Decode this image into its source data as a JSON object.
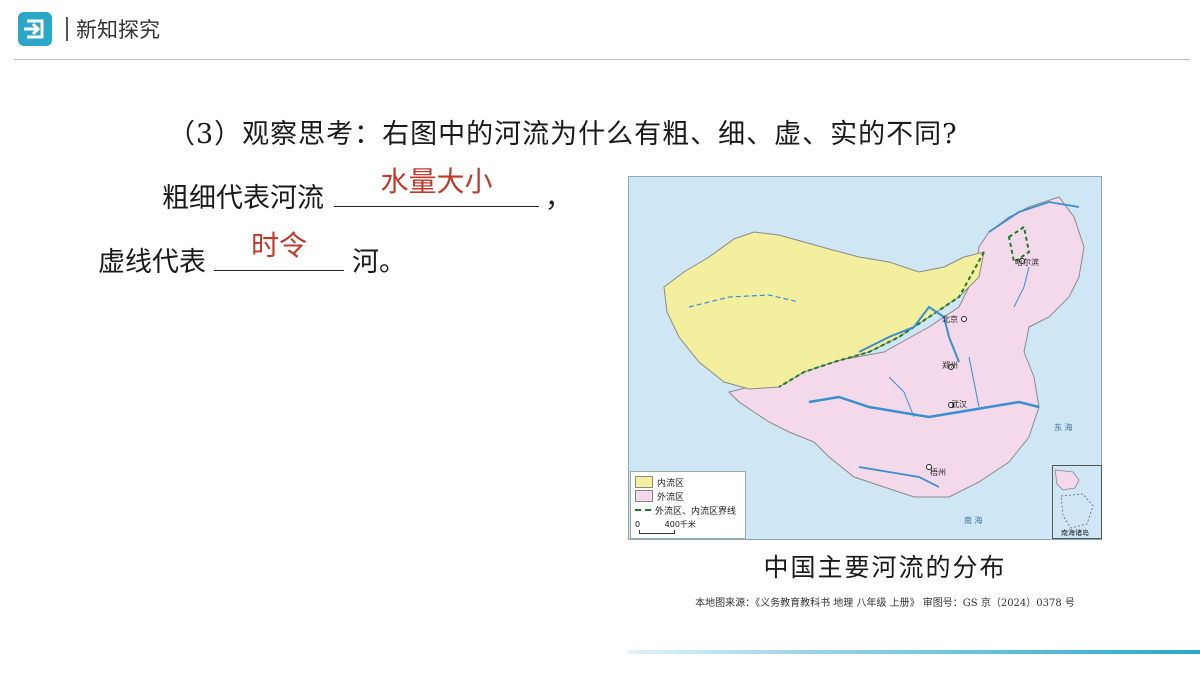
{
  "header": {
    "logo_icon": "return-arrow-icon",
    "title": "新知探究",
    "accent_color": "#2aa7c9"
  },
  "question": {
    "text": "（3）观察思考：右图中的河流为什么有粗、细、虚、实的不同?"
  },
  "line1": {
    "prefix": "粗细代表河流",
    "answer": "水量大小",
    "suffix": "，"
  },
  "line2": {
    "prefix": "虚线代表",
    "answer": "时令",
    "suffix": "河。"
  },
  "answer_color": "#c0392b",
  "map": {
    "legend": {
      "inland": "内流区",
      "outflow": "外流区",
      "boundary": "外流区、内流区界线",
      "scale_zero": "0",
      "scale_label": "400千米"
    },
    "cities": {
      "harbin": "哈尔滨",
      "beijing": "北京",
      "zhengzhou": "郑州",
      "wuhan": "武汉",
      "wuzhou": "梧州"
    },
    "seas": {
      "donghai": "东 海",
      "nanhai": "南 海"
    },
    "inset_label": "南海诸岛",
    "caption": "中国主要河流的分布",
    "source": "本地图来源：《义务教育教科书 地理 八年级 上册》 审图号：GS 京（2024）0378 号",
    "colors": {
      "inland": "#f3ef9e",
      "outflow": "#f3d9ea",
      "boundary": "#1e7a2e",
      "river": "#3a8fd0",
      "sea": "#cfe6f5"
    }
  }
}
